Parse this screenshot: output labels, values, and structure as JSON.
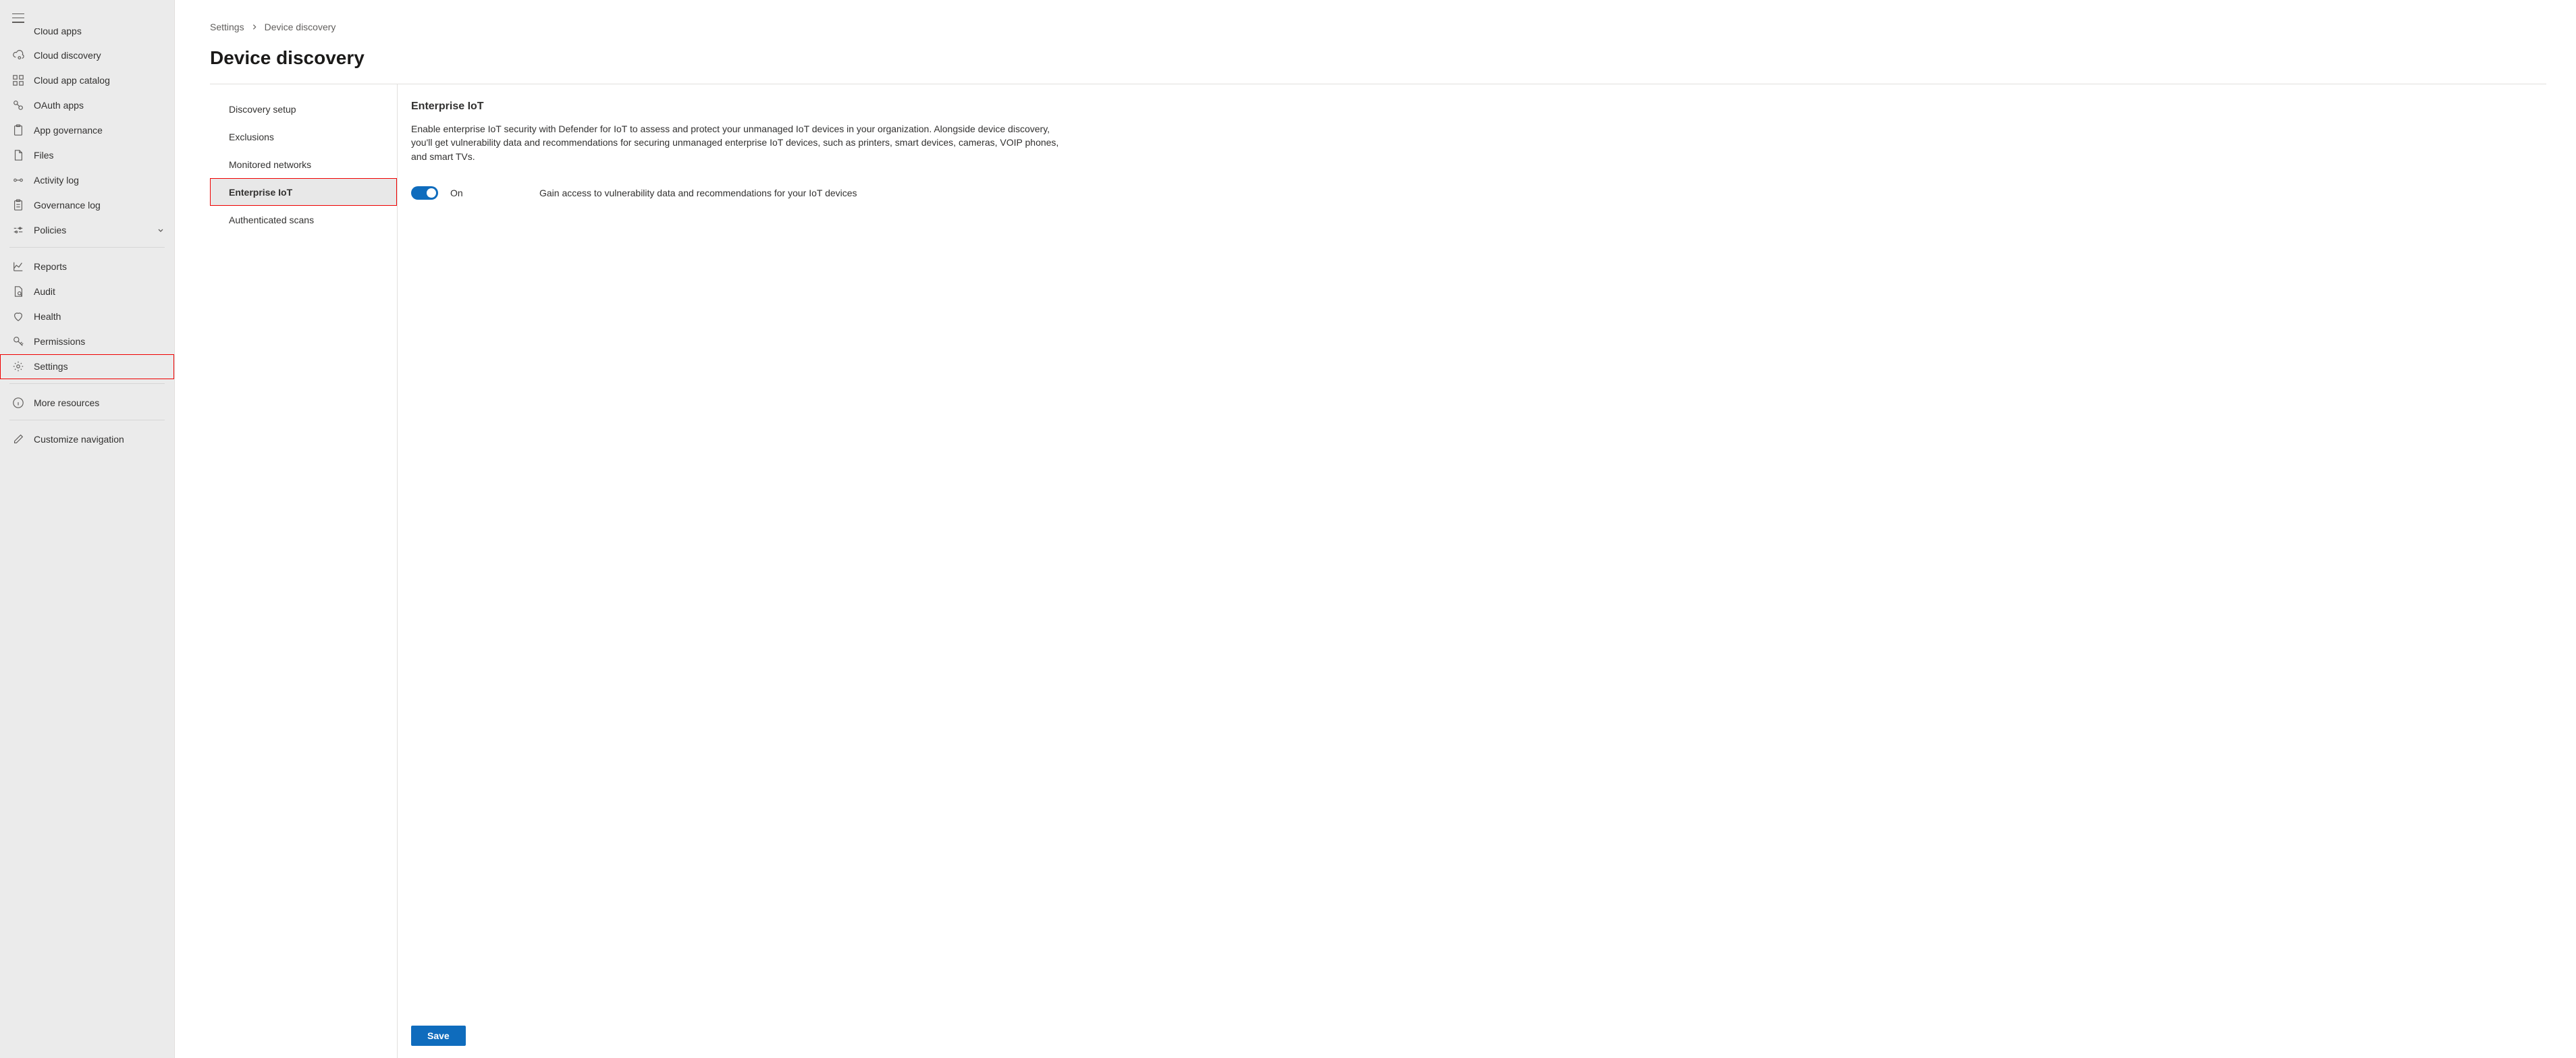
{
  "sidebar": {
    "items": [
      {
        "label": "Cloud apps",
        "icon": "cloud-apps"
      },
      {
        "label": "Cloud discovery",
        "icon": "cloud-discovery"
      },
      {
        "label": "Cloud app catalog",
        "icon": "catalog"
      },
      {
        "label": "OAuth apps",
        "icon": "oauth"
      },
      {
        "label": "App governance",
        "icon": "clipboard"
      },
      {
        "label": "Files",
        "icon": "files"
      },
      {
        "label": "Activity log",
        "icon": "activity"
      },
      {
        "label": "Governance log",
        "icon": "clipboard"
      },
      {
        "label": "Policies",
        "icon": "policies",
        "expandable": true
      }
    ],
    "items2": [
      {
        "label": "Reports",
        "icon": "reports"
      },
      {
        "label": "Audit",
        "icon": "audit"
      },
      {
        "label": "Health",
        "icon": "health"
      },
      {
        "label": "Permissions",
        "icon": "permissions"
      },
      {
        "label": "Settings",
        "icon": "settings",
        "highlight": true
      }
    ],
    "items3": [
      {
        "label": "More resources",
        "icon": "info"
      }
    ],
    "items4": [
      {
        "label": "Customize navigation",
        "icon": "pencil"
      }
    ]
  },
  "breadcrumb": {
    "root": "Settings",
    "current": "Device discovery"
  },
  "page": {
    "title": "Device discovery"
  },
  "subnav": {
    "items": [
      {
        "label": "Discovery setup"
      },
      {
        "label": "Exclusions"
      },
      {
        "label": "Monitored networks"
      },
      {
        "label": "Enterprise IoT",
        "selected": true,
        "highlight": true
      },
      {
        "label": "Authenticated scans"
      }
    ]
  },
  "detail": {
    "title": "Enterprise IoT",
    "description": "Enable enterprise IoT security with Defender for IoT to assess and protect your unmanaged IoT devices in your organization. Alongside device discovery, you'll get vulnerability data and recommendations for securing unmanaged enterprise IoT devices, such as printers, smart devices, cameras, VOIP phones, and smart TVs.",
    "toggle_state": "On",
    "toggle_desc": "Gain access to vulnerability data and recommendations for your IoT devices",
    "save_label": "Save"
  }
}
